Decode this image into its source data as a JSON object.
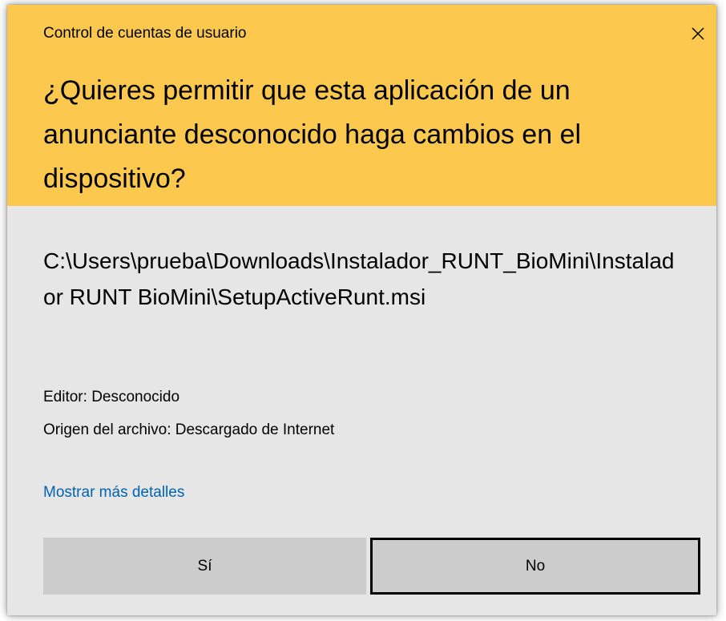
{
  "dialog": {
    "title": "Control de cuentas de usuario",
    "question": "¿Quieres permitir que esta aplicación de un anunciante desconocido haga cambios en el dispositivo?",
    "file_path": "C:\\Users\\prueba\\Downloads\\Instalador_RUNT_BioMini\\Instalador RUNT BioMini\\SetupActiveRunt.msi",
    "publisher": "Editor: Desconocido",
    "file_origin": "Origen del archivo: Descargado de Internet",
    "more_details_link": "Mostrar más detalles",
    "yes_label": "Sí",
    "no_label": "No",
    "close_icon": "close-icon"
  },
  "colors": {
    "header_background": "#fcc94e",
    "body_background": "#e6e6e6",
    "link": "#0063b1",
    "button_background": "#cccccc",
    "focused_button_border": "#000000"
  }
}
